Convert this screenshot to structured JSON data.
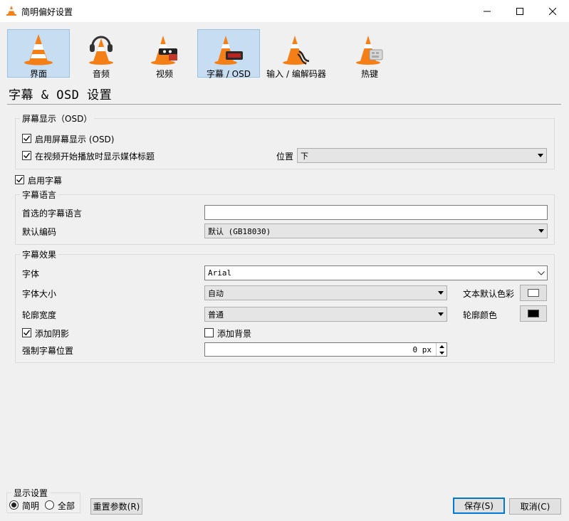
{
  "window": {
    "title": "简明偏好设置"
  },
  "categories": [
    {
      "label": "界面",
      "icon": "vlc-cone-icon"
    },
    {
      "label": "音频",
      "icon": "headphones-cone-icon"
    },
    {
      "label": "视频",
      "icon": "film-cone-icon"
    },
    {
      "label": "字幕 / OSD",
      "icon": "clock-cone-icon"
    },
    {
      "label": "输入 / 编解码器",
      "icon": "cable-cone-icon"
    },
    {
      "label": "热键",
      "icon": "keyboard-cone-icon"
    }
  ],
  "active_category": "字幕 / OSD",
  "page_title": "字幕 & OSD 设置",
  "osd": {
    "legend": "屏幕显示（OSD）",
    "enable_osd": {
      "label": "启用屏幕显示 (OSD)",
      "checked": true
    },
    "show_title": {
      "label": "在视频开始播放时显示媒体标题",
      "checked": true
    },
    "position_label": "位置",
    "position_value": "下"
  },
  "enable_subtitles": {
    "label": "启用字幕",
    "checked": true
  },
  "language": {
    "legend": "字幕语言",
    "preferred_label": "首选的字幕语言",
    "preferred_value": "",
    "encoding_label": "默认编码",
    "encoding_value": "默认 (GB18030)"
  },
  "effects": {
    "legend": "字幕效果",
    "font_label": "字体",
    "font_value": "Arial",
    "size_label": "字体大小",
    "size_value": "自动",
    "text_color_label": "文本默认色彩",
    "text_color": "#ffffff",
    "outline_label": "轮廓宽度",
    "outline_value": "普通",
    "outline_color_label": "轮廓颜色",
    "outline_color": "#000000",
    "shadow": {
      "label": "添加阴影",
      "checked": true
    },
    "background": {
      "label": "添加背景",
      "checked": false
    },
    "force_pos_label": "强制字幕位置",
    "force_pos_value": "0 px"
  },
  "footer": {
    "display_legend": "显示设置",
    "simple_label": "简明",
    "all_label": "全部",
    "selected": "简明",
    "reset_label": "重置参数(R)",
    "save_label": "保存(S)",
    "cancel_label": "取消(C)"
  },
  "colors": {
    "accent": "#0078d7",
    "cone_orange": "#f47f16",
    "active_bg": "#c7ddf2"
  }
}
